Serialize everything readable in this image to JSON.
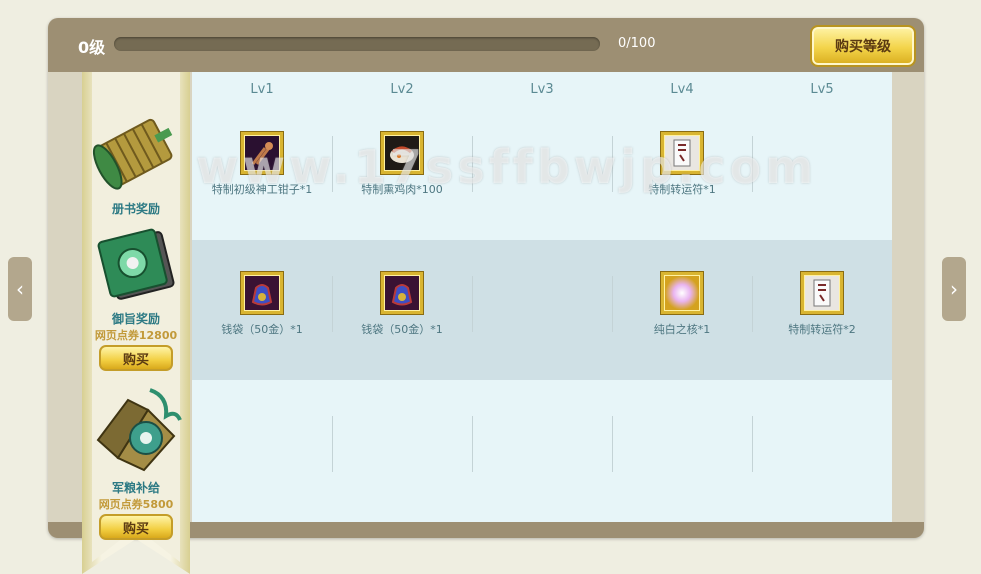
{
  "header": {
    "level": "0级",
    "xp_text": "0/100",
    "xp_progress": 0,
    "buy_level_label": "购买等级"
  },
  "levels": [
    "Lv1",
    "Lv2",
    "Lv3",
    "Lv4",
    "Lv5"
  ],
  "rewards": [
    {
      "name": "册书奖励",
      "price": "",
      "buy_label": "",
      "items": [
        {
          "col": 0,
          "name": "特制初级神工钳子*1",
          "icon": "pliers-icon"
        },
        {
          "col": 1,
          "name": "特制熏鸡肉*100",
          "icon": "smoked-chicken-icon"
        },
        {
          "col": 3,
          "name": "特制转运符*1",
          "icon": "luck-talisman-icon"
        }
      ]
    },
    {
      "name": "御旨奖励",
      "price": "网页点券12800",
      "buy_label": "购买",
      "items": [
        {
          "col": 0,
          "name": "钱袋（50金）*1",
          "icon": "money-bag-icon"
        },
        {
          "col": 1,
          "name": "钱袋（50金）*1",
          "icon": "money-bag-icon"
        },
        {
          "col": 3,
          "name": "纯白之核*1",
          "icon": "white-core-icon"
        },
        {
          "col": 4,
          "name": "特制转运符*2",
          "icon": "luck-talisman-icon"
        }
      ]
    },
    {
      "name": "军粮补给",
      "price": "网页点券5800",
      "buy_label": "购买",
      "items": []
    }
  ],
  "watermark": "www.17ssffbwjp.com",
  "colors": {
    "panel_header": "#9d8f73",
    "accent_gold": "#e8c64a",
    "grid_bg": "#e7f5f8",
    "band_bg": "#cfe0e5",
    "label_teal": "#2d7a84"
  }
}
